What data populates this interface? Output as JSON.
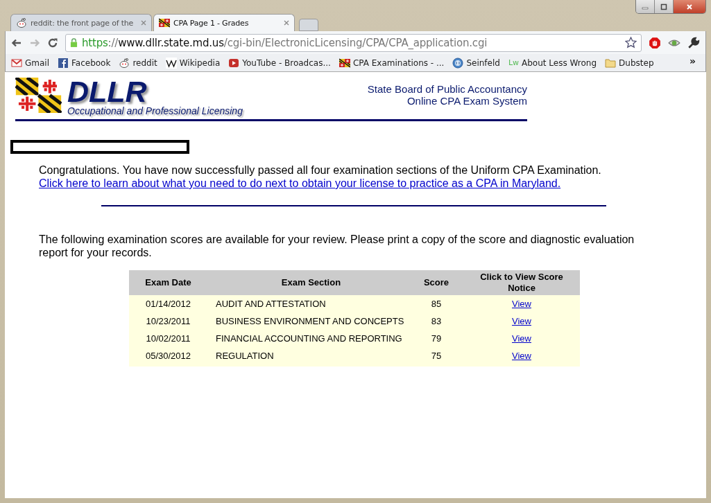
{
  "tabs": [
    {
      "title": "reddit: the front page of the",
      "kind": "reddit",
      "selected": false
    },
    {
      "title": "CPA Page 1 - Grades",
      "kind": "flag",
      "selected": true
    }
  ],
  "address": {
    "scheme": "https",
    "separator": "://",
    "host": "www.dllr.state.md.us",
    "path": "/cgi-bin/ElectronicLicensing/CPA/CPA_application.cgi"
  },
  "bookmarks": [
    {
      "label": "Gmail",
      "kind": "gmail"
    },
    {
      "label": "Facebook",
      "kind": "facebook"
    },
    {
      "label": "reddit",
      "kind": "reddit"
    },
    {
      "label": "Wikipedia",
      "kind": "wikipedia"
    },
    {
      "label": "YouTube - Broadcas...",
      "kind": "youtube"
    },
    {
      "label": "CPA Examinations - ...",
      "kind": "flag"
    },
    {
      "label": "Seinfeld",
      "kind": "globe"
    },
    {
      "label": "About Less Wrong",
      "kind": "lw",
      "icon_text": "Lw"
    },
    {
      "label": "Dubstep",
      "kind": "folder"
    }
  ],
  "overflow": "»",
  "header": {
    "logo": "DLLR",
    "subtitle": "Occupational and Professional Licensing",
    "board": "State Board of Public Accountancy",
    "system": "Online CPA Exam System"
  },
  "congrats": {
    "text": "Congratulations. You have now successfully passed all four examination sections of the Uniform CPA Examination.",
    "link": "Click here to learn about what you need to do next to obtain your license to practice as a CPA in Maryland."
  },
  "intro": "The following examination scores are available for your review. Please print a copy of the score and diagnostic evaluation report for your records.",
  "table": {
    "columns": [
      "Exam Date",
      "Exam Section",
      "Score",
      "Click to View Score Notice"
    ],
    "rows": [
      {
        "date": "01/14/2012",
        "section": "AUDIT AND ATTESTATION",
        "score": "85",
        "link": "View"
      },
      {
        "date": "10/23/2011",
        "section": "BUSINESS ENVIRONMENT AND CONCEPTS",
        "score": "83",
        "link": "View"
      },
      {
        "date": "10/02/2011",
        "section": "FINANCIAL ACCOUNTING AND REPORTING",
        "score": "79",
        "link": "View"
      },
      {
        "date": "05/30/2012",
        "section": "REGULATION",
        "score": "75",
        "link": "View"
      }
    ]
  }
}
